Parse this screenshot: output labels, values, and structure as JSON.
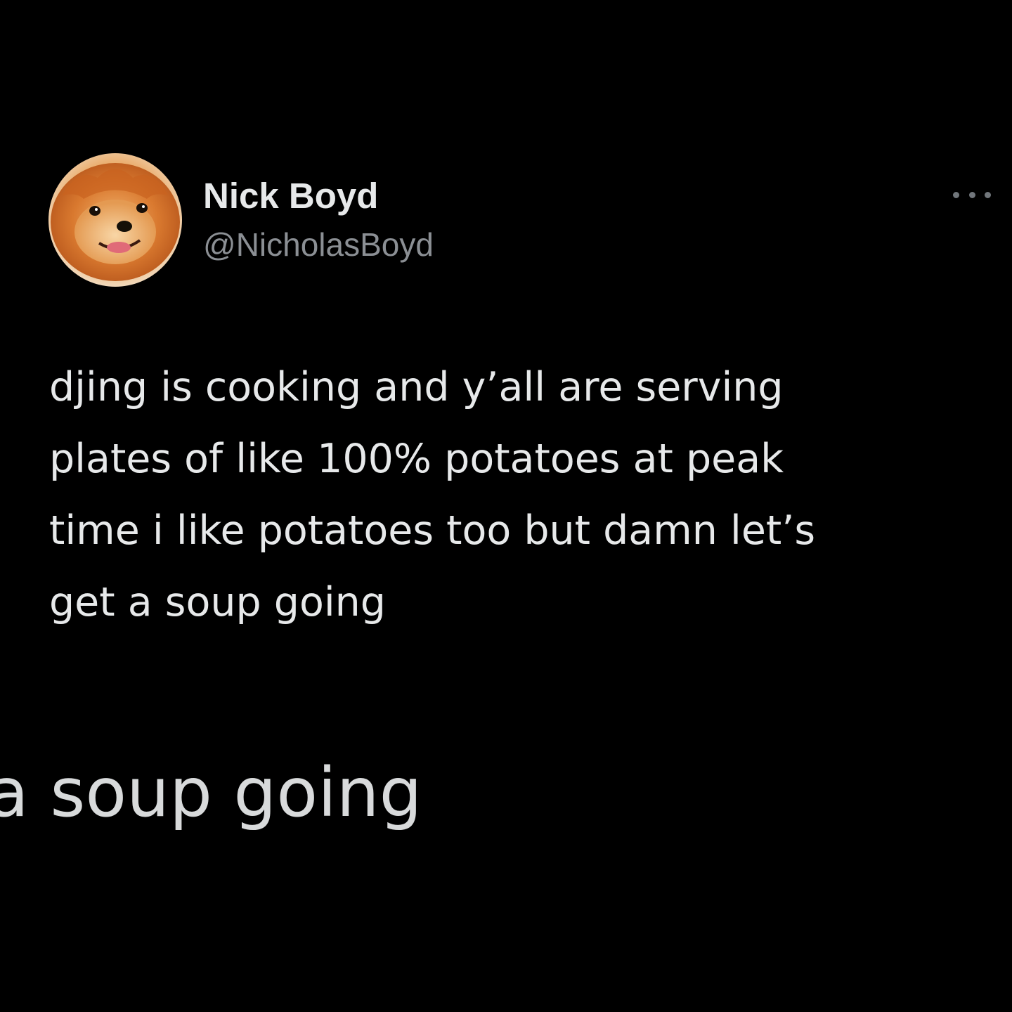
{
  "author": {
    "name": "Nick Boyd",
    "handle": "@NicholasBoyd",
    "avatar_icon": "pomeranian-avatar"
  },
  "more_icon": "more-options-icon",
  "tweet": {
    "lines": [
      "djing is cooking and y’all are serving",
      "plates of like 100% potatoes at peak",
      "time i like potatoes too but damn let’s",
      "get a soup going"
    ]
  },
  "overlay_text": "a soup going",
  "colors": {
    "background": "#000000",
    "primary_text": "#e7e9ea",
    "secondary_text": "#8b8f94"
  }
}
